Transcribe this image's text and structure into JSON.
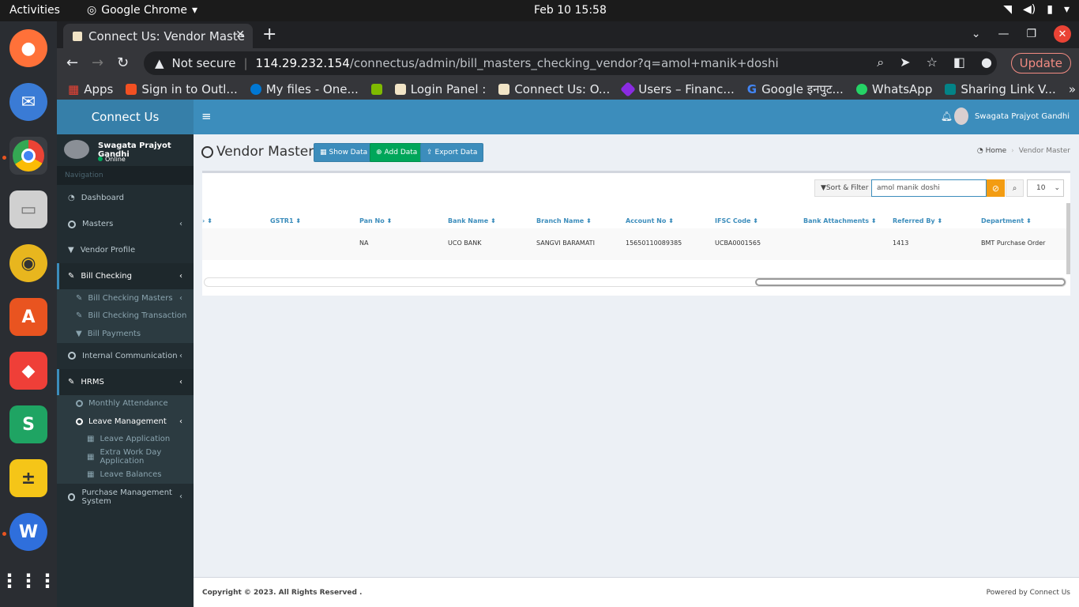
{
  "os": {
    "activities": "Activities",
    "app_name": "Google Chrome",
    "clock": "Feb 10  15:58"
  },
  "browser": {
    "tab_title": "Connect Us: Vendor Maste",
    "url_not_secure": "Not secure",
    "url_host": "114.29.232.154",
    "url_path": "/connectus/admin/bill_masters_checking_vendor?q=amol+manik+doshi",
    "update_label": "Update",
    "bookmarks": [
      {
        "label": "Apps",
        "color": "#ea4335"
      },
      {
        "label": "Sign in to Outl...",
        "color": "#f25022"
      },
      {
        "label": "My files - One...",
        "color": "#0078d4"
      },
      {
        "label": "",
        "color": "#7fba00"
      },
      {
        "label": "Login Panel :",
        "color": "#f1e4c6"
      },
      {
        "label": "Connect Us: O...",
        "color": "#f1e4c6"
      },
      {
        "label": "Users – Financ...",
        "color": "#8a2be2"
      },
      {
        "label": "Google इनपुट...",
        "color": "#4285f4"
      },
      {
        "label": "WhatsApp",
        "color": "#25d366"
      },
      {
        "label": "Sharing Link V...",
        "color": "#038387"
      }
    ]
  },
  "sidebar": {
    "brand": "Connect Us",
    "user_name": "Swagata Prajyot Gandhi",
    "user_status": "Online",
    "nav_label": "Navigation",
    "items": {
      "dashboard": "Dashboard",
      "masters": "Masters",
      "vendor_profile": "Vendor Profile",
      "bill_checking": "Bill Checking",
      "bill_checking_masters": "Bill Checking Masters",
      "bill_checking_transaction": "Bill Checking Transaction",
      "bill_payments": "Bill Payments",
      "internal_communication": "Internal Communication",
      "hrms": "HRMS",
      "monthly_attendance": "Monthly Attendance",
      "leave_management": "Leave Management",
      "leave_application": "Leave Application",
      "extra_work_day": "Extra Work Day Application",
      "leave_balances": "Leave Balances",
      "purchase_management": "Purchase Management System"
    }
  },
  "header": {
    "user_name": "Swagata Prajyot Gandhi"
  },
  "content": {
    "page_title": "Vendor Master",
    "show_data": "Show Data",
    "add_data": "Add Data",
    "export_data": "Export Data",
    "breadcrumb_home": "Home",
    "breadcrumb_current": "Vendor Master",
    "sort_filter": "Sort & Filter",
    "search_value": "amol manik doshi",
    "page_size": "10"
  },
  "table": {
    "columns": [
      "GSTR1",
      "Pan No",
      "Bank Name",
      "Branch Name",
      "Account No",
      "IFSC Code",
      "Bank Attachments",
      "Referred By",
      "Department"
    ],
    "rows": [
      [
        "",
        "NA",
        "UCO BANK",
        "SANGVI BARAMATI",
        "15650110089385",
        "UCBA0001565",
        "",
        "1413",
        "BMT Purchase Order"
      ]
    ]
  },
  "footer": {
    "copyright": "Copyright © 2023. All Rights Reserved .",
    "powered": "Powered by Connect Us"
  },
  "colors": {
    "primary": "#3c8dbc",
    "sidebar": "#222d32",
    "success": "#00a65a",
    "warning": "#f39c12"
  }
}
